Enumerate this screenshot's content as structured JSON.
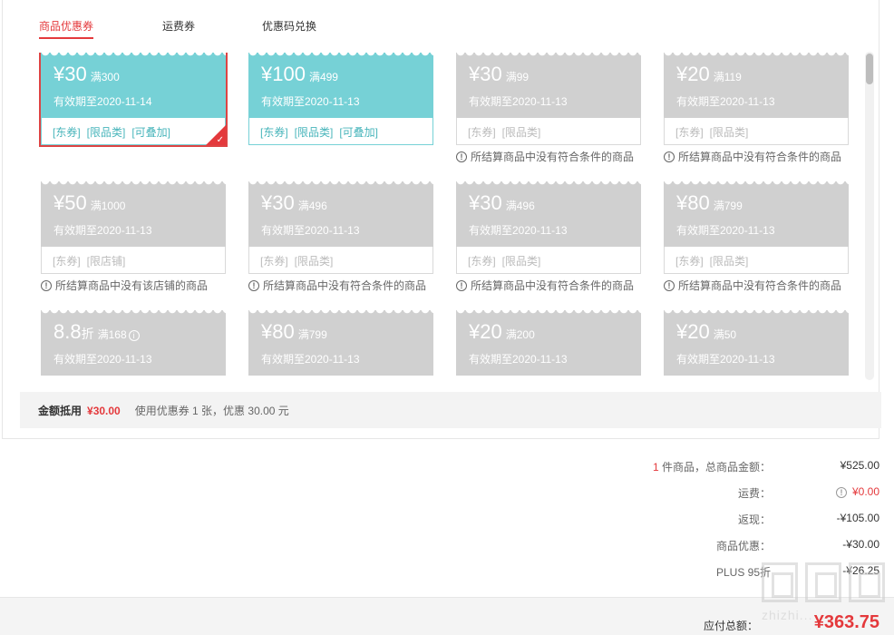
{
  "tabs": [
    {
      "label": "商品优惠券"
    },
    {
      "label": "运费券"
    },
    {
      "label": "优惠码兑换"
    }
  ],
  "colors": {
    "accent": "#e4393c",
    "teal": "#76d1d6",
    "disabled": "#d0d0d0"
  },
  "coupons": [
    {
      "amount": "¥30",
      "cond": "满300",
      "expiry": "有效期至2020-11-14",
      "tags": [
        "[东券]",
        "[限品类]",
        "[可叠加]"
      ],
      "note": ""
    },
    {
      "amount": "¥100",
      "cond": "满499",
      "expiry": "有效期至2020-11-13",
      "tags": [
        "[东券]",
        "[限品类]",
        "[可叠加]"
      ],
      "note": ""
    },
    {
      "amount": "¥30",
      "cond": "满99",
      "expiry": "有效期至2020-11-13",
      "tags": [
        "[东券]",
        "[限品类]"
      ],
      "note": "所结算商品中没有符合条件的商品"
    },
    {
      "amount": "¥20",
      "cond": "满119",
      "expiry": "有效期至2020-11-13",
      "tags": [
        "[东券]",
        "[限品类]"
      ],
      "note": "所结算商品中没有符合条件的商品"
    },
    {
      "amount": "¥50",
      "cond": "满1000",
      "expiry": "有效期至2020-11-13",
      "tags": [
        "[东券]",
        "[限店铺]"
      ],
      "note": "所结算商品中没有该店铺的商品"
    },
    {
      "amount": "¥30",
      "cond": "满496",
      "expiry": "有效期至2020-11-13",
      "tags": [
        "[东券]",
        "[限品类]"
      ],
      "note": "所结算商品中没有符合条件的商品"
    },
    {
      "amount": "¥30",
      "cond": "满496",
      "expiry": "有效期至2020-11-13",
      "tags": [
        "[东券]",
        "[限品类]"
      ],
      "note": "所结算商品中没有符合条件的商品"
    },
    {
      "amount": "¥80",
      "cond": "满799",
      "expiry": "有效期至2020-11-13",
      "tags": [
        "[东券]",
        "[限品类]"
      ],
      "note": "所结算商品中没有符合条件的商品"
    },
    {
      "amount": "8.8",
      "unit": "折",
      "cond": "满168",
      "expiry": "有效期至2020-11-13",
      "tags": [],
      "note": ""
    },
    {
      "amount": "¥80",
      "cond": "满799",
      "expiry": "有效期至2020-11-13",
      "tags": [],
      "note": ""
    },
    {
      "amount": "¥20",
      "cond": "满200",
      "expiry": "有效期至2020-11-13",
      "tags": [],
      "note": ""
    },
    {
      "amount": "¥20",
      "cond": "满50",
      "expiry": "有效期至2020-11-13",
      "tags": [],
      "note": ""
    }
  ],
  "summary": {
    "label": "金额抵用",
    "amount": "¥30.00",
    "desc": "使用优惠券 1 张，优惠 30.00 元"
  },
  "totals": {
    "items_qty": "1",
    "items_label": " 件商品，总商品金额：",
    "items_value": "¥525.00",
    "shipping_label": "运费：",
    "shipping_value": "¥0.00",
    "cashback_label": "返现：",
    "cashback_value": "-¥105.00",
    "discount_label": "商品优惠：",
    "discount_value": "-¥30.00",
    "plus_label": "PLUS 95折",
    "plus_value": "-¥26.25"
  },
  "payable": {
    "label": "应付总额：",
    "value": "¥363.75"
  },
  "watermark": {
    "text": "zhizhi..."
  }
}
